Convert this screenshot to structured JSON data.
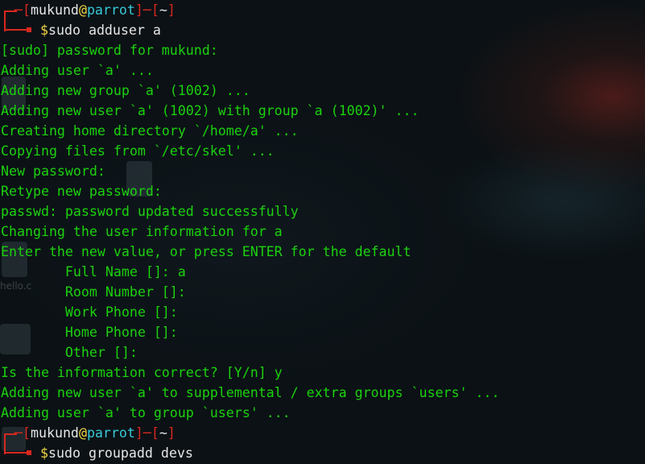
{
  "prompt1": {
    "user": "mukund",
    "at": "@",
    "host": "parrot",
    "dir": "~",
    "symbol": "$",
    "command": "sudo adduser a"
  },
  "output": [
    "[sudo] password for mukund:",
    "Adding user `a' ...",
    "Adding new group `a' (1002) ...",
    "Adding new user `a' (1002) with group `a (1002)' ...",
    "Creating home directory `/home/a' ...",
    "Copying files from `/etc/skel' ...",
    "New password:",
    "Retype new password:",
    "passwd: password updated successfully",
    "Changing the user information for a",
    "Enter the new value, or press ENTER for the default",
    "        Full Name []: a",
    "        Room Number []:",
    "        Work Phone []:",
    "        Home Phone []:",
    "        Other []:",
    "Is the information correct? [Y/n] y",
    "Adding new user `a' to supplemental / extra groups `users' ...",
    "Adding user `a' to group `users' ..."
  ],
  "prompt2": {
    "user": "mukund",
    "at": "@",
    "host": "parrot",
    "dir": "~",
    "symbol": "$",
    "command": "sudo groupadd devs"
  },
  "desktop": {
    "label1": "hello.c"
  },
  "colors": {
    "output": "#1cd10e",
    "prompt_bracket": "#d8281f",
    "host": "#38c8d8",
    "symbol": "#f2d544",
    "background": "#0b1115"
  }
}
